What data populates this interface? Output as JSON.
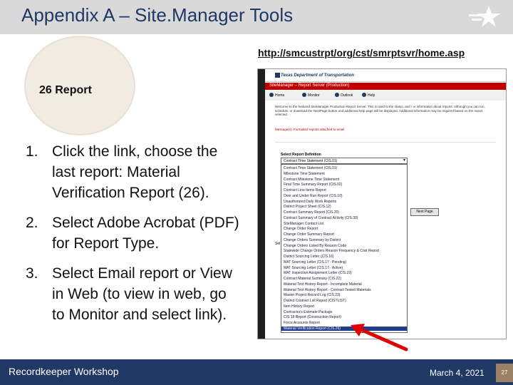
{
  "slide": {
    "title": "Appendix A – Site.Manager Tools",
    "link": "http://smcustrpt/org/cst/smrptsvr/home.asp",
    "circle_label": "26 Report",
    "steps": [
      {
        "num": "1.",
        "text": "Click the link, choose the last report: Material Verification Report (26)."
      },
      {
        "num": "2.",
        "text": "Select Adobe Acrobat (PDF) for Report Type."
      },
      {
        "num": "3.",
        "text": "Select Email report or View in Web (to view in web, go to Monitor and select link)."
      }
    ],
    "footer_left": "Recordkeeper Workshop",
    "footer_date": "March 4, 2021",
    "page_number": "27"
  },
  "screenshot": {
    "org": "Texas Department of Transportation",
    "app_bar": "SiteManager – Report Server (Production)",
    "nav": [
      "Home",
      "Monitor",
      "Outlook",
      "Help"
    ],
    "welcome": "Welcome to the featured SiteManager Production Report Server. This is used to the status, and / or information about reports. Although you can run, schedule, or download the NextPage button and additional help page will be displayed. Additional information may be required based on the report selected.",
    "message": "Message(s): Formatted reports attached to email",
    "select_label": "Select Report Definition",
    "select_value": "Contract Time Statement (CIS.01)",
    "next_button": "Next Page",
    "side_hint": "Sel",
    "options": [
      "Contract Time Statement (CIS.01)",
      "Milestone Time Statement",
      "Contract Milestone Time Statement",
      "Final Time Summary Report (CIS.02)",
      "Contract Line Items Report",
      "Over and Under Run Report (CIS.10)",
      "Unauthorized Daily Work Reports",
      "District Project Sheet (CIS.12)",
      "Contract Summary Report (CIS.20)",
      "Contract Summary of Contract Activity (CIS.30)",
      "SiteManager Contact List",
      "Change Order Report",
      "Change Order Summary Report",
      "Change Orders Summary by District",
      "Change Orders Listed By Reason Code",
      "Statewide Change Orders Reason Frequency & Cost Report",
      "District Sourcing Letter (CIS.16)",
      "MAT Sourcing Letter (CIS.17 - Pending)",
      "MAT Sourcing Letter (CIS.17 - Active)",
      "MAT Inspection Assignment Letter (CIS.19)",
      "Contract Material Summary (CIS.22)",
      "Material Test History Report - Incomplete Material",
      "Material Test History Report - Contract Tested Materials",
      "Master Project Record Log (CIS.23)",
      "District Contract List Report (CISTLIST)",
      "Item History Report",
      "Contractor's Estimate Package",
      "CIS 18 Report (Construction Report)",
      "Force Accounts Report",
      "Material Verification Report (CIS.26)"
    ],
    "selected_option_index": 29
  },
  "colors": {
    "title_text": "#1f3864",
    "title_bar": "#d9d9d9",
    "footer_bg": "#1f3864",
    "page_badge": "#9b8066",
    "app_bar": "#c00000",
    "arrow": "#e00000",
    "circle_fill": "#f2ebe2"
  }
}
